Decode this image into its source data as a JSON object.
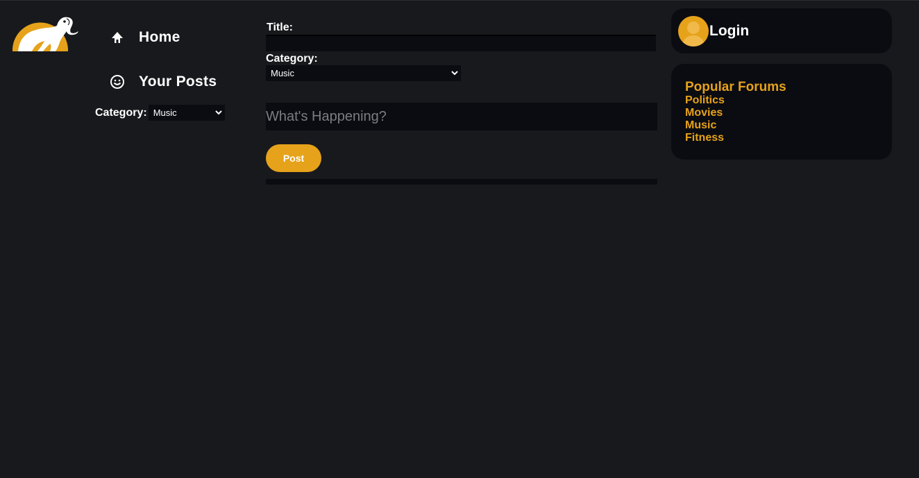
{
  "colors": {
    "accent": "#e6a21a",
    "background": "#18191d",
    "panel": "#0b0c12"
  },
  "nav": {
    "home_label": "Home",
    "home_icon": "home-icon",
    "posts_label": "Your Posts",
    "posts_icon": "smiley-icon",
    "category_label": "Category:",
    "category_selected": "Music"
  },
  "composer": {
    "title_label": "Title:",
    "title_value": "",
    "category_label": "Category:",
    "category_selected": "Music",
    "body_placeholder": "What's Happening?",
    "post_label": "Post"
  },
  "login": {
    "label": "Login",
    "avatar_icon": "user-avatar-icon"
  },
  "forums": {
    "title": "Popular Forums",
    "items": [
      "Politics",
      "Movies",
      "Music",
      "Fitness"
    ]
  }
}
